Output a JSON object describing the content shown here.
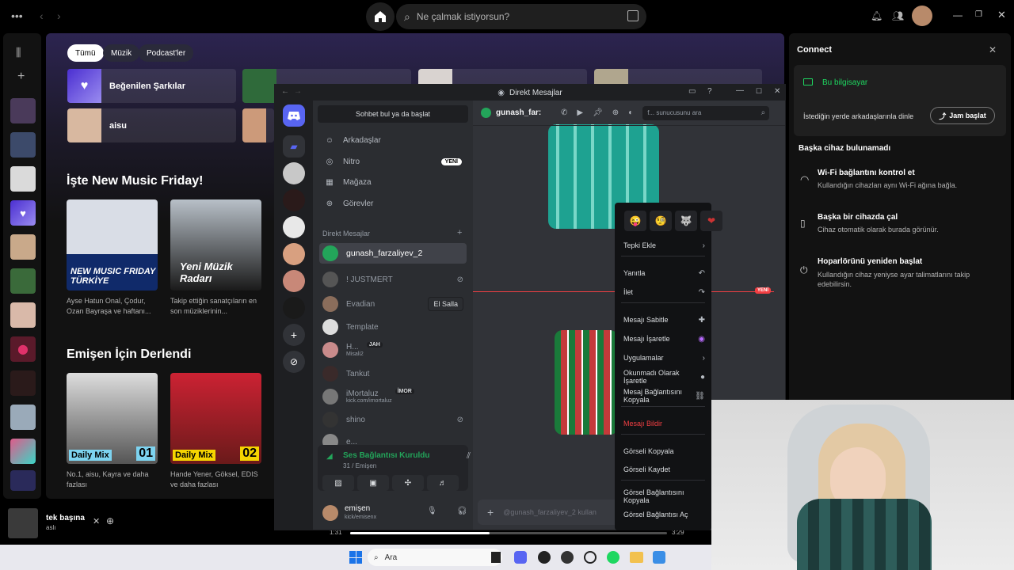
{
  "spotify": {
    "search_placeholder": "Ne çalmak istiyorsun?",
    "filters": [
      "Tümü",
      "Müzik",
      "Podcast'ler"
    ],
    "shortcuts": [
      {
        "label": "Beğenilen Şarkılar"
      },
      {
        "label": "aisu"
      }
    ],
    "section1": "İşte New Music Friday!",
    "cards1": [
      {
        "art_text": "NEW MUSIC FRIDAY TÜRKİYE",
        "caption": "Ayse Hatun Onal, Çodur, Ozan Bayraşa ve haftanı..."
      },
      {
        "art_text": "Yeni Müzik Radarı",
        "caption": "Takip ettiğin sanatçıların en son müziklerinin..."
      }
    ],
    "section2": "Emişen İçin Derlendi",
    "cards2": [
      {
        "tag": "Daily Mix",
        "num": "01",
        "caption": "No.1, aisu, Kayra ve daha fazlası"
      },
      {
        "tag": "Daily Mix",
        "num": "02",
        "caption": "Hande Yener, Göksel, EDIS ve daha fazlası"
      }
    ],
    "now_playing": {
      "title": "tek başına",
      "artist": "aslı",
      "elapsed": "1:31",
      "total": "3:29",
      "progress": 0.44
    },
    "connect": {
      "title": "Connect",
      "this_device": "Bu bilgisayar",
      "listen_anywhere": "İstediğin yerde arkadaşlarınla dinle",
      "jam_button": "Jam başlat",
      "none_found": "Başka cihaz bulunamadı",
      "tips": [
        {
          "title": "Wi-Fi bağlantını kontrol et",
          "desc": "Kullandığın cihazları aynı Wi-Fi ağına bağla."
        },
        {
          "title": "Başka bir cihazda çal",
          "desc": "Cihaz otomatik olarak burada görünür."
        },
        {
          "title": "Hoparlörünü yeniden başlat",
          "desc": "Kullandığın cihaz yeniyse ayar talimatlarını takip edebilirsin."
        }
      ]
    }
  },
  "discord": {
    "window_title": "Direkt Mesajlar",
    "find_placeholder": "Sohbet bul ya da başlat",
    "nav": [
      {
        "label": "Arkadaşlar",
        "icon": "friends-icon"
      },
      {
        "label": "Nitro",
        "icon": "nitro-icon",
        "badge": "YENİ"
      },
      {
        "label": "Mağaza",
        "icon": "shop-icon"
      },
      {
        "label": "Görevler",
        "icon": "quests-icon"
      }
    ],
    "dm_header": "Direkt Mesajlar",
    "dms": [
      {
        "name": "gunash_farzaliyev_2",
        "color": "#23a55a",
        "active": true
      },
      {
        "name": "! JUSTMERT",
        "color": "#555"
      },
      {
        "name": "Evadian",
        "color": "#8a6d5b",
        "action": "El Salla"
      },
      {
        "name": "Template",
        "color": "#ddd"
      },
      {
        "name": "H...",
        "sub": "Misali2",
        "tag": "JAH",
        "color": "#c98b8b"
      },
      {
        "name": "Tankut",
        "color": "#3a2a2a"
      },
      {
        "name": "iMortaluz",
        "sub": "kick.com/imortaluz",
        "tag": "İMOR",
        "color": "#777"
      },
      {
        "name": "shino",
        "color": "#333"
      },
      {
        "name": "e...",
        "color": "#888"
      }
    ],
    "voice": {
      "status": "Ses Bağlantısı Kuruldu",
      "channel": "31 / Emişen"
    },
    "user": {
      "name": "emişen",
      "status": "kick/emisenx"
    },
    "chat_user": "gunash_far:",
    "server_search": "f... sunucusunu ara",
    "new_badge": "YENİ",
    "message_placeholder": "@gunash_farzaliyev_2 kullan",
    "context_menu": [
      {
        "label": "Tepki Ekle",
        "icon": "chevron-right-icon"
      },
      {
        "label": "Yanıtla",
        "icon": "reply-icon"
      },
      {
        "label": "İlet",
        "icon": "forward-icon"
      },
      {
        "label": "Mesajı Sabitle",
        "icon": "pin-icon"
      },
      {
        "label": "Mesajı İşaretle",
        "icon": "mark-icon"
      },
      {
        "label": "Uygulamalar",
        "icon": "chevron-right-icon"
      },
      {
        "label": "Okunmadı Olarak İşaretle",
        "icon": "unread-icon"
      },
      {
        "label": "Mesaj Bağlantısını Kopyala",
        "icon": "link-icon"
      },
      {
        "label": "Mesajı Bildir",
        "danger": true
      },
      {
        "label": "Görseli Kopyala"
      },
      {
        "label": "Görseli Kaydet"
      },
      {
        "label": "Görsel Bağlantısını Kopyala"
      },
      {
        "label": "Görsel Bağlantısı Aç"
      }
    ]
  },
  "taskbar": {
    "search": "Ara"
  }
}
